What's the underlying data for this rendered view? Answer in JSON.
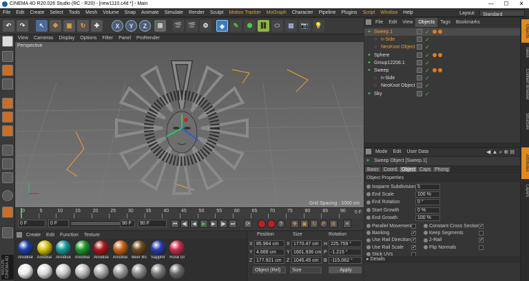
{
  "window": {
    "title": "CINEMA 4D R20.026 Studio (RC - R20) - [new1110.c4d *] - Main",
    "minimize": "—",
    "maximize": "☐",
    "close": "✕"
  },
  "menubar": {
    "items": [
      "File",
      "Edit",
      "Create",
      "Select",
      "Tools",
      "Mesh",
      "Volume",
      "Snap",
      "Animate",
      "Simulate",
      "Render",
      "Sculpt",
      "Motion Tracker",
      "MoGraph",
      "Character",
      "Pipeline",
      "Plugins",
      "Script",
      "Window",
      "Help"
    ],
    "layout_label": "Layout:",
    "layout_value": "Standard"
  },
  "toolbar": {
    "x": "X",
    "y": "Y",
    "z": "Z"
  },
  "viewport": {
    "menu": [
      "View",
      "Cameras",
      "Display",
      "Options",
      "Filter",
      "Panel",
      "ProRender"
    ],
    "camera_label": "Perspective",
    "grid_spacing": "Grid Spacing : 1000 cm"
  },
  "timeline": {
    "ticks": [
      "0",
      "5",
      "10",
      "15",
      "20",
      "25",
      "30",
      "35",
      "40",
      "45",
      "50",
      "55",
      "60",
      "65",
      "70",
      "75",
      "80",
      "85",
      "90"
    ],
    "end_marker": "0 F",
    "start_field": "0 F",
    "min_field": "0 F",
    "max_field": "90 F",
    "end_field": "90 F",
    "current_frame": 0,
    "max_frame": 90
  },
  "materials": {
    "menu": [
      "Create",
      "Edit",
      "Function",
      "Texture"
    ],
    "row1": [
      {
        "label": "Anodise",
        "color": "#1b3fa8"
      },
      {
        "label": "Anodise",
        "color": "#d8c310"
      },
      {
        "label": "Anodise",
        "color": "#1a9a9a"
      },
      {
        "label": "Anodise",
        "color": "#1d9a2a"
      },
      {
        "label": "Anodise",
        "color": "#b01818"
      },
      {
        "label": "Anodise",
        "color": "#c86418"
      },
      {
        "label": "Beer Bo",
        "color": "#6e4a1c"
      },
      {
        "label": "Sapphir",
        "color": "#2a3cb0"
      },
      {
        "label": "Rose Gl",
        "color": "#c8304a"
      }
    ],
    "row2_colors": [
      "#eeeeee",
      "#dddddd",
      "#cccccc",
      "#bbbbbb",
      "#aaaaaa",
      "#999999",
      "#888888",
      "#777777",
      "#666666"
    ]
  },
  "coordinates": {
    "headers": {
      "position": "Position",
      "size": "Size",
      "rotation": "Rotation"
    },
    "rows": [
      {
        "axis": "X",
        "position": "85.964 cm",
        "size_axis": "X",
        "size": "1770.47 cm",
        "rot_axis": "H",
        "rotation": "225.759 °"
      },
      {
        "axis": "Y",
        "position": "4.668 cm",
        "size_axis": "Y",
        "size": "1601.936 cm",
        "rot_axis": "P",
        "rotation": "-1.215 °"
      },
      {
        "axis": "Z",
        "position": "177.921 cm",
        "size_axis": "Z",
        "size": "1045.45 cm",
        "rot_axis": "B",
        "rotation": "-115.062 °"
      }
    ],
    "mode_select": "Object (Rel)",
    "size_select": "Size",
    "apply_label": "Apply"
  },
  "objects": {
    "menu": [
      "File",
      "Edit",
      "View",
      "Objects",
      "Tags",
      "Bookmarks"
    ],
    "active_tab": "Objects",
    "rows": [
      {
        "name": "Sweep.1",
        "indent": 0,
        "color": "#f0a030",
        "tags": 2,
        "selected": true
      },
      {
        "name": "n-Side",
        "indent": 1,
        "color": "#f0a030",
        "tags": 0,
        "selected": false
      },
      {
        "name": "NeoKnot Object",
        "indent": 1,
        "color": "#f0a030",
        "tags": 0,
        "selected": false
      },
      {
        "name": "Sphere",
        "indent": 0,
        "color": "#ddd",
        "tags": 2,
        "selected": false
      },
      {
        "name": "Group12208.1",
        "indent": 0,
        "color": "#ddd",
        "tags": 0,
        "selected": false
      },
      {
        "name": "Sweep",
        "indent": 0,
        "color": "#ddd",
        "tags": 2,
        "selected": false
      },
      {
        "name": "n-Side",
        "indent": 1,
        "color": "#ddd",
        "tags": 0,
        "selected": false
      },
      {
        "name": "NeoKnot Object",
        "indent": 1,
        "color": "#ddd",
        "tags": 0,
        "selected": false
      },
      {
        "name": "Sky",
        "indent": 0,
        "color": "#ddd",
        "tags": 0,
        "selected": false
      }
    ]
  },
  "side_tabs": [
    "Objects",
    "Takes",
    "Content Browser",
    "Structure",
    "Attributes",
    "Layers"
  ],
  "attributes": {
    "menu": [
      "Mode",
      "Edit",
      "User Data"
    ],
    "title": "Sweep Object [Sweep.1]",
    "tabs": [
      "Basic",
      "Coord.",
      "Object",
      "Caps",
      "Phong"
    ],
    "active_tab": "Object",
    "section": "Object Properties",
    "fields": [
      {
        "label": "Isoparm Subdivision",
        "value": "5"
      },
      {
        "label": "End Scale",
        "value": "100 %"
      },
      {
        "label": "End Rotation",
        "value": "0 °"
      },
      {
        "label": "Start Growth",
        "value": "0 %"
      },
      {
        "label": "End Growth",
        "value": "100 %"
      }
    ],
    "checks_left": [
      {
        "label": "Parallel Movement",
        "checked": false
      },
      {
        "label": "Banking",
        "checked": true
      },
      {
        "label": "Use Rail Direction",
        "checked": true
      },
      {
        "label": "Use Rail Scale",
        "checked": true
      },
      {
        "label": "Stick UVs",
        "checked": false
      }
    ],
    "checks_right": [
      {
        "label": "Constant Cross Section",
        "checked": true
      },
      {
        "label": "Keep Segments",
        "checked": false
      },
      {
        "label": "2-Rail",
        "checked": true
      },
      {
        "label": "Flip Normals",
        "checked": false
      }
    ],
    "details": "Details"
  },
  "colors": {
    "accent": "#f0a030",
    "selected_obj": "#f0a030",
    "check_green": "#44cc44"
  }
}
